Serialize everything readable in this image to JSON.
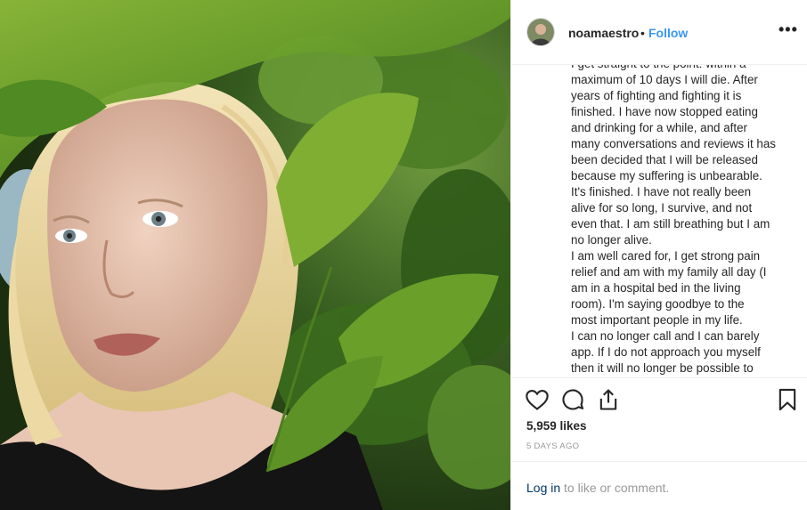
{
  "post": {
    "username": "noamaestro",
    "separator": "•",
    "follow_label": "Follow",
    "more_label": "•••",
    "caption_lines": [
      "I get straight to the point: within a",
      "maximum of 10 days I will die. After",
      "years of fighting and fighting it is",
      "finished. I have now stopped eating",
      "and drinking for a while, and after",
      "many conversations and reviews it has",
      "been decided that I will be released",
      "because my suffering is unbearable.",
      "It's finished. I have not really been",
      "alive for so long, I survive, and not",
      "even that. I am still breathing but I am",
      "no longer alive.",
      "I am well cared for, I get strong pain",
      "relief and am with my family all day (I",
      "am in a hospital bed in the living",
      "room). I'm saying goodbye to the",
      "most important people in my life.",
      "I can no longer call and I can barely",
      "app. If I do not approach you myself",
      "then it will no longer be possible to"
    ],
    "likes": "5,959 likes",
    "age": "5 DAYS AGO",
    "login_link": "Log in",
    "login_suffix": " to like or comment."
  },
  "icons": {
    "like": "heart-icon",
    "comment": "comment-icon",
    "share": "share-icon",
    "save": "bookmark-icon",
    "more": "more-options-icon"
  },
  "colors": {
    "accent": "#3897f0",
    "text": "#262626",
    "muted": "#999999",
    "link": "#003569"
  }
}
